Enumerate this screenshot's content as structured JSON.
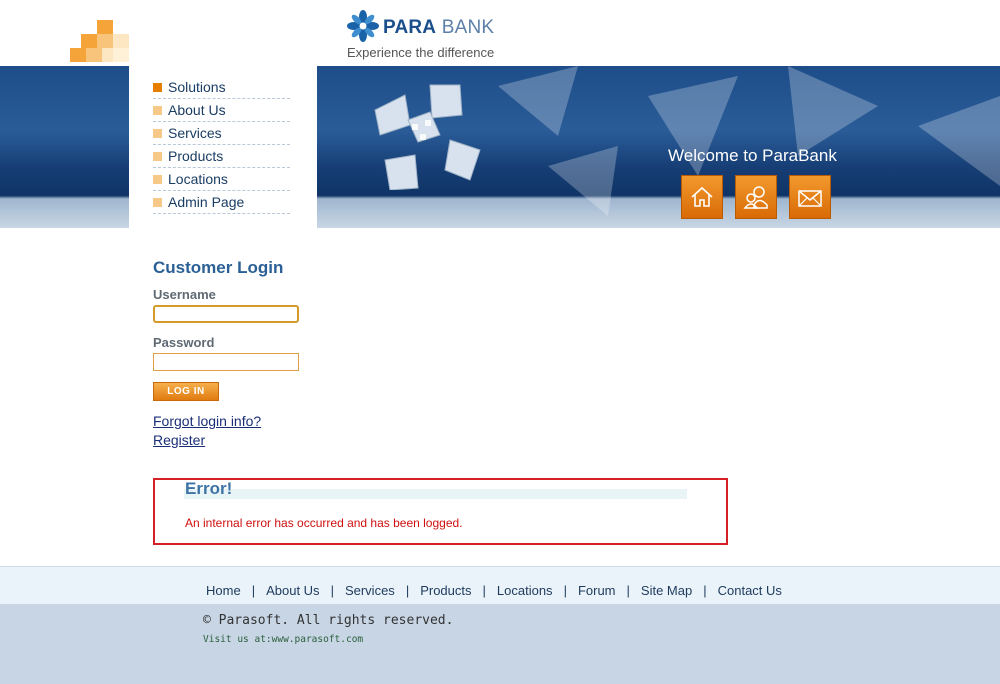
{
  "brand": {
    "name_bold": "PARA",
    "name_light": " BANK",
    "tagline": "Experience the difference"
  },
  "banner": {
    "welcome": "Welcome to ParaBank",
    "icons": [
      "home-icon",
      "about-people-icon",
      "contact-envelope-icon"
    ]
  },
  "menu": {
    "items": [
      {
        "label": "Solutions"
      },
      {
        "label": "About Us"
      },
      {
        "label": "Services"
      },
      {
        "label": "Products"
      },
      {
        "label": "Locations"
      },
      {
        "label": "Admin Page"
      }
    ]
  },
  "login": {
    "title": "Customer Login",
    "username_label": "Username",
    "username_value": "",
    "password_label": "Password",
    "password_value": "",
    "button_label": "LOG IN",
    "forgot_link": "Forgot login info?",
    "register_link": "Register"
  },
  "error": {
    "title": "Error!",
    "message": "An internal error has occurred and has been logged."
  },
  "footer": {
    "links": [
      "Home",
      "About Us",
      "Services",
      "Products",
      "Locations",
      "Forum",
      "Site Map",
      "Contact Us"
    ],
    "separator": "|",
    "copyright": "© Parasoft. All rights reserved.",
    "visit": "Visit us at:www.parasoft.com"
  },
  "colors": {
    "accent_orange": "#e67e00",
    "brand_blue": "#1a4f8b",
    "error_red": "#d62028",
    "banner_blue": "#1e4e8a"
  }
}
